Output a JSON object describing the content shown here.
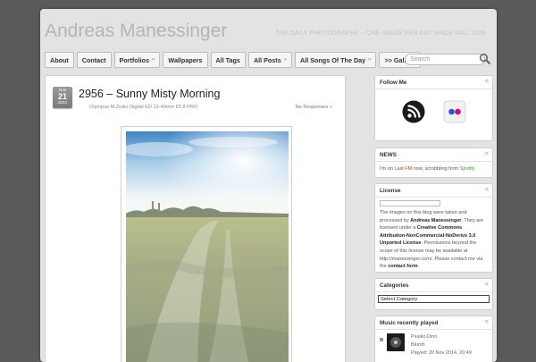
{
  "site": {
    "title": "Andreas Manessinger",
    "tagline": "THE DAILY PHOTOGRAPHY – ONE IMAGE PER DAY SINCE FALL 2006"
  },
  "nav": {
    "items": [
      {
        "label": "About",
        "dropdown": false
      },
      {
        "label": "Contact",
        "dropdown": false
      },
      {
        "label": "Portfolios",
        "dropdown": true
      },
      {
        "label": "Wallpapers",
        "dropdown": false
      },
      {
        "label": "All Tags",
        "dropdown": false
      },
      {
        "label": "All Posts",
        "dropdown": true
      },
      {
        "label": "All Songs Of The Day",
        "dropdown": true
      },
      {
        "label": ">> Gallery",
        "dropdown": false
      }
    ],
    "dropdown_glyph": "»"
  },
  "search": {
    "placeholder": "Search"
  },
  "post": {
    "date": {
      "month": "Nov",
      "day": "21",
      "year": "2014"
    },
    "title": "2956 – Sunny Misty Morning",
    "meta": "Olympus M.Zuiko Digital ED 12-40mm f/2.8 PRO",
    "comments": "No Responses »"
  },
  "sidebar": {
    "follow": {
      "title": "Follow Me",
      "icons": [
        "rss-icon",
        "flickr-icon"
      ]
    },
    "news": {
      "title": "NEWS",
      "text_before": "I'm on ",
      "link1": "Last.FM",
      "text_mid": " now, scrobbling from ",
      "link2": "Spotify"
    },
    "license": {
      "title": "License",
      "text1": "The images on this blog were taken and processed by ",
      "author": "Andreas Manessinger",
      "text2": ". They are licensed under a ",
      "license_name": "Creative Commons Attribution-NonCommercial-NoDerivs 3.0 Unported License",
      "text3": ". Permissions beyond the scope of this license may be available at http://manessinger.com/. Please contact me via the ",
      "contact": "contact form",
      "text4": "."
    },
    "categories": {
      "title": "Categories",
      "selected": "Select Category"
    },
    "music": {
      "title": "Music recently played",
      "artist": "Psaiko.Dino",
      "track": "Blumh",
      "played": "Played: 20 Nov 2014, 20:49"
    },
    "collapse_glyph": "<"
  },
  "colors": {
    "background": "#5a5a5a",
    "page": "#e3e3e3",
    "title": "#b5b5b5",
    "red_link": "#c0392b",
    "green_link": "#3a9a3a"
  }
}
